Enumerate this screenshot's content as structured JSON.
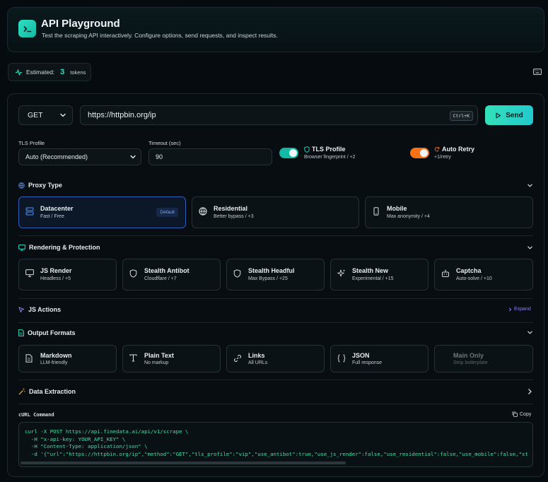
{
  "header": {
    "title": "API Playground",
    "subtitle": "Test the scraping API interactively. Configure options, send requests, and inspect results."
  },
  "estimate": {
    "label": "Estimated:",
    "value": "3",
    "unit": "tokens"
  },
  "request": {
    "method": "GET",
    "url": "https://httpbin.org/ip",
    "shortcut": "Ctrl+K",
    "send_label": "Send"
  },
  "options": {
    "tls_label": "TLS Profile",
    "tls_value": "Auto (Recommended)",
    "timeout_label": "Timeout (sec)",
    "timeout_value": "90",
    "tls_toggle": {
      "title": "TLS Profile",
      "subtitle": "Browser fingerprint / +2",
      "on": true
    },
    "retry_toggle": {
      "title": "Auto Retry",
      "subtitle": "+1/retry",
      "on": true
    }
  },
  "sections": {
    "proxy": "Proxy Type",
    "rendering": "Rendering & Protection",
    "js_actions": "JS Actions",
    "js_expand": "Expand",
    "output": "Output Formats",
    "extraction": "Data Extraction"
  },
  "proxy_cards": [
    {
      "title": "Datacenter",
      "subtitle": "Fast / Free",
      "badge": "Default",
      "icon": "server-icon"
    },
    {
      "title": "Residential",
      "subtitle": "Better bypass / +3",
      "icon": "globe-icon"
    },
    {
      "title": "Mobile",
      "subtitle": "Max anonymity / +4",
      "icon": "smartphone-icon"
    }
  ],
  "rendering_cards": [
    {
      "title": "JS Render",
      "subtitle": "Headless / +5",
      "icon": "monitor-icon"
    },
    {
      "title": "Stealth Antibot",
      "subtitle": "Cloudflare / +7",
      "icon": "shield-icon"
    },
    {
      "title": "Stealth Headful",
      "subtitle": "Max Bypass / +25",
      "icon": "shield-icon"
    },
    {
      "title": "Stealth New",
      "subtitle": "Experimental / +15",
      "icon": "sparkles-icon"
    },
    {
      "title": "Captcha",
      "subtitle": "Auto-solve / +10",
      "icon": "bot-icon"
    }
  ],
  "output_cards": [
    {
      "title": "Markdown",
      "subtitle": "LLM-friendly",
      "icon": "file-text-icon"
    },
    {
      "title": "Plain Text",
      "subtitle": "No markup",
      "icon": "type-icon"
    },
    {
      "title": "Links",
      "subtitle": "All URLs",
      "icon": "link-icon"
    },
    {
      "title": "JSON",
      "subtitle": "Full response",
      "icon": "braces-icon"
    },
    {
      "title": "Main Only",
      "subtitle": "Strip boilerplate",
      "disabled": true
    }
  ],
  "curl": {
    "label": "cURL Command",
    "copy_label": "Copy",
    "lines": [
      "curl -X POST https://api.finedata.ai/api/v1/scrape \\",
      "  -H \"x-api-key: YOUR_API_KEY\" \\",
      "  -H \"Content-Type: application/json\" \\",
      "  -d '{\"url\":\"https://httpbin.org/ip\",\"method\":\"GET\",\"tls_profile\":\"vip\",\"use_antibot\":true,\"use_js_render\":false,\"use_residential\":false,\"use_mobile\":false,\"st"
    ]
  },
  "colors": {
    "accent": "#2ee0c0",
    "toggle_on": "#14b8a6",
    "toggle_warn": "#f97316",
    "selected_border": "#2f5db8",
    "curl_text": "#3ee0a4"
  }
}
